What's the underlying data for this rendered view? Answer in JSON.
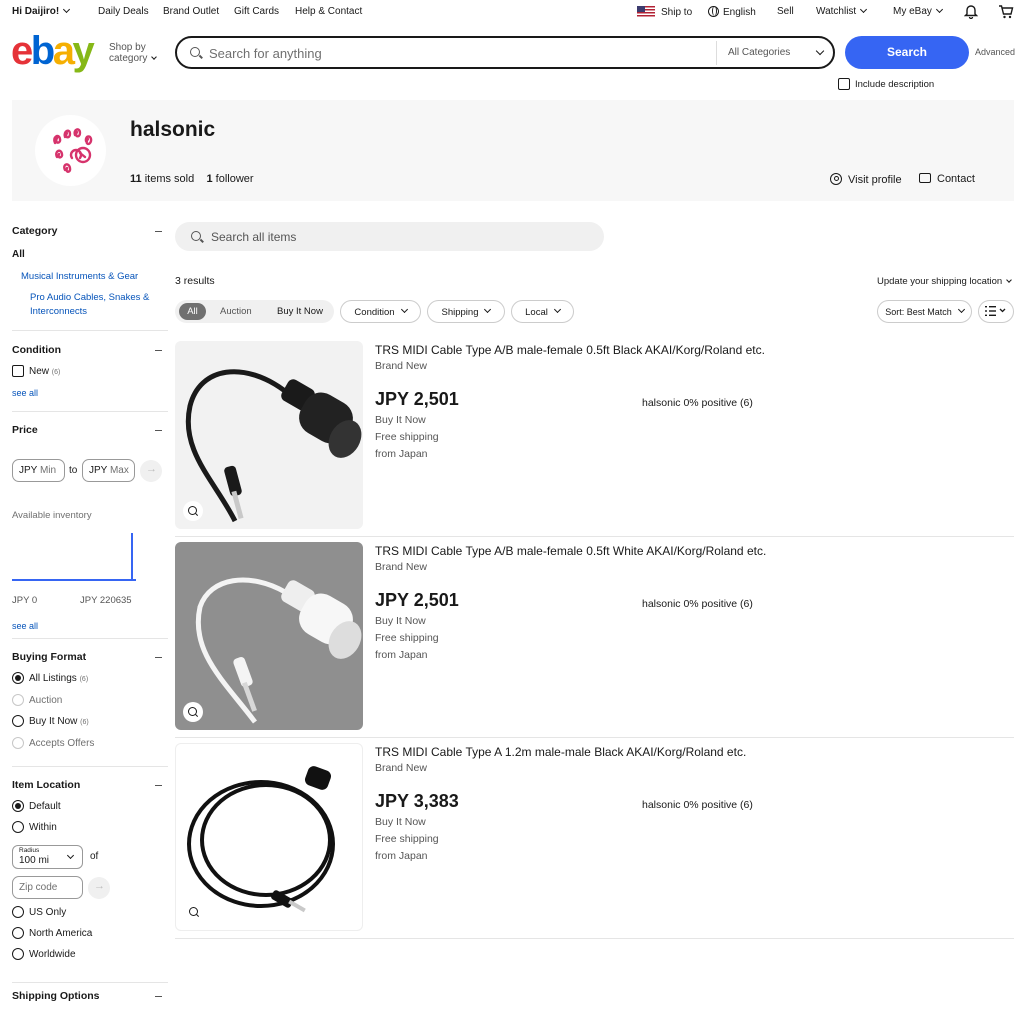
{
  "topbar": {
    "greeting": "Hi Daijiro!",
    "links": [
      "Daily Deals",
      "Brand Outlet",
      "Gift Cards",
      "Help & Contact"
    ],
    "ship_to": "Ship to",
    "language": "English",
    "sell": "Sell",
    "watchlist": "Watchlist",
    "my_ebay": "My eBay"
  },
  "header": {
    "logo": [
      "e",
      "b",
      "a",
      "y"
    ],
    "shop_by_1": "Shop by",
    "shop_by_2": "category",
    "search_placeholder": "Search for anything",
    "category_select": "All Categories",
    "search_button": "Search",
    "advanced": "Advanced",
    "include_description": "Include description"
  },
  "store": {
    "name": "halsonic",
    "items_sold_count": "11",
    "items_sold_label": "items sold",
    "followers_count": "1",
    "followers_label": "follower",
    "visit_profile": "Visit profile",
    "contact": "Contact"
  },
  "sidebar": {
    "category": {
      "title": "Category",
      "all": "All",
      "items": [
        "Musical Instruments & Gear",
        "Pro Audio Cables, Snakes &",
        "Interconnects"
      ]
    },
    "condition": {
      "title": "Condition",
      "new_label": "New",
      "new_count": "(6)",
      "see_all": "see all"
    },
    "price": {
      "title": "Price",
      "currency": "JPY",
      "min": "Min",
      "to": "to",
      "max": "Max",
      "available": "Available inventory",
      "range_low": "JPY 0",
      "range_high": "JPY 220635",
      "see_all": "see all"
    },
    "buying_format": {
      "title": "Buying Format",
      "all_listings": "All Listings",
      "all_count": "(6)",
      "auction": "Auction",
      "buy_it_now": "Buy It Now",
      "bin_count": "(6)",
      "accepts_offers": "Accepts Offers"
    },
    "location": {
      "title": "Item Location",
      "default": "Default",
      "within": "Within",
      "radius_label": "Radius",
      "radius_value": "100 mi",
      "of": "of",
      "zip_placeholder": "Zip code",
      "us_only": "US Only",
      "north_america": "North America",
      "worldwide": "Worldwide"
    },
    "shipping_options": "Shipping Options"
  },
  "main": {
    "search_placeholder": "Search all items",
    "results": "3 results",
    "update_shipping": "Update your shipping location",
    "filters": {
      "all": "All",
      "auction": "Auction",
      "buy_it_now": "Buy It Now",
      "condition": "Condition",
      "shipping": "Shipping",
      "local": "Local",
      "sort": "Sort: Best Match"
    },
    "listings": [
      {
        "title": "TRS MIDI Cable Type A/B male-female 0.5ft Black AKAI/Korg/Roland etc.",
        "condition": "Brand New",
        "price": "JPY 2,501",
        "format": "Buy It Now",
        "shipping": "Free shipping",
        "from": "from Japan",
        "seller": "halsonic 0% positive (6)"
      },
      {
        "title": "TRS MIDI Cable Type A/B male-female 0.5ft White AKAI/Korg/Roland etc.",
        "condition": "Brand New",
        "price": "JPY 2,501",
        "format": "Buy It Now",
        "shipping": "Free shipping",
        "from": "from Japan",
        "seller": "halsonic 0% positive (6)"
      },
      {
        "title": "TRS MIDI Cable Type A 1.2m male-male Black AKAI/Korg/Roland etc.",
        "condition": "Brand New",
        "price": "JPY 3,383",
        "format": "Buy It Now",
        "shipping": "Free shipping",
        "from": "from Japan",
        "seller": "halsonic 0% positive (6)"
      }
    ]
  },
  "colors": {
    "accent": "#3665f3",
    "link": "#0654ba",
    "logo_e": "#e53238",
    "logo_b": "#0064d2",
    "logo_a": "#f5af02",
    "logo_y": "#86b817"
  }
}
